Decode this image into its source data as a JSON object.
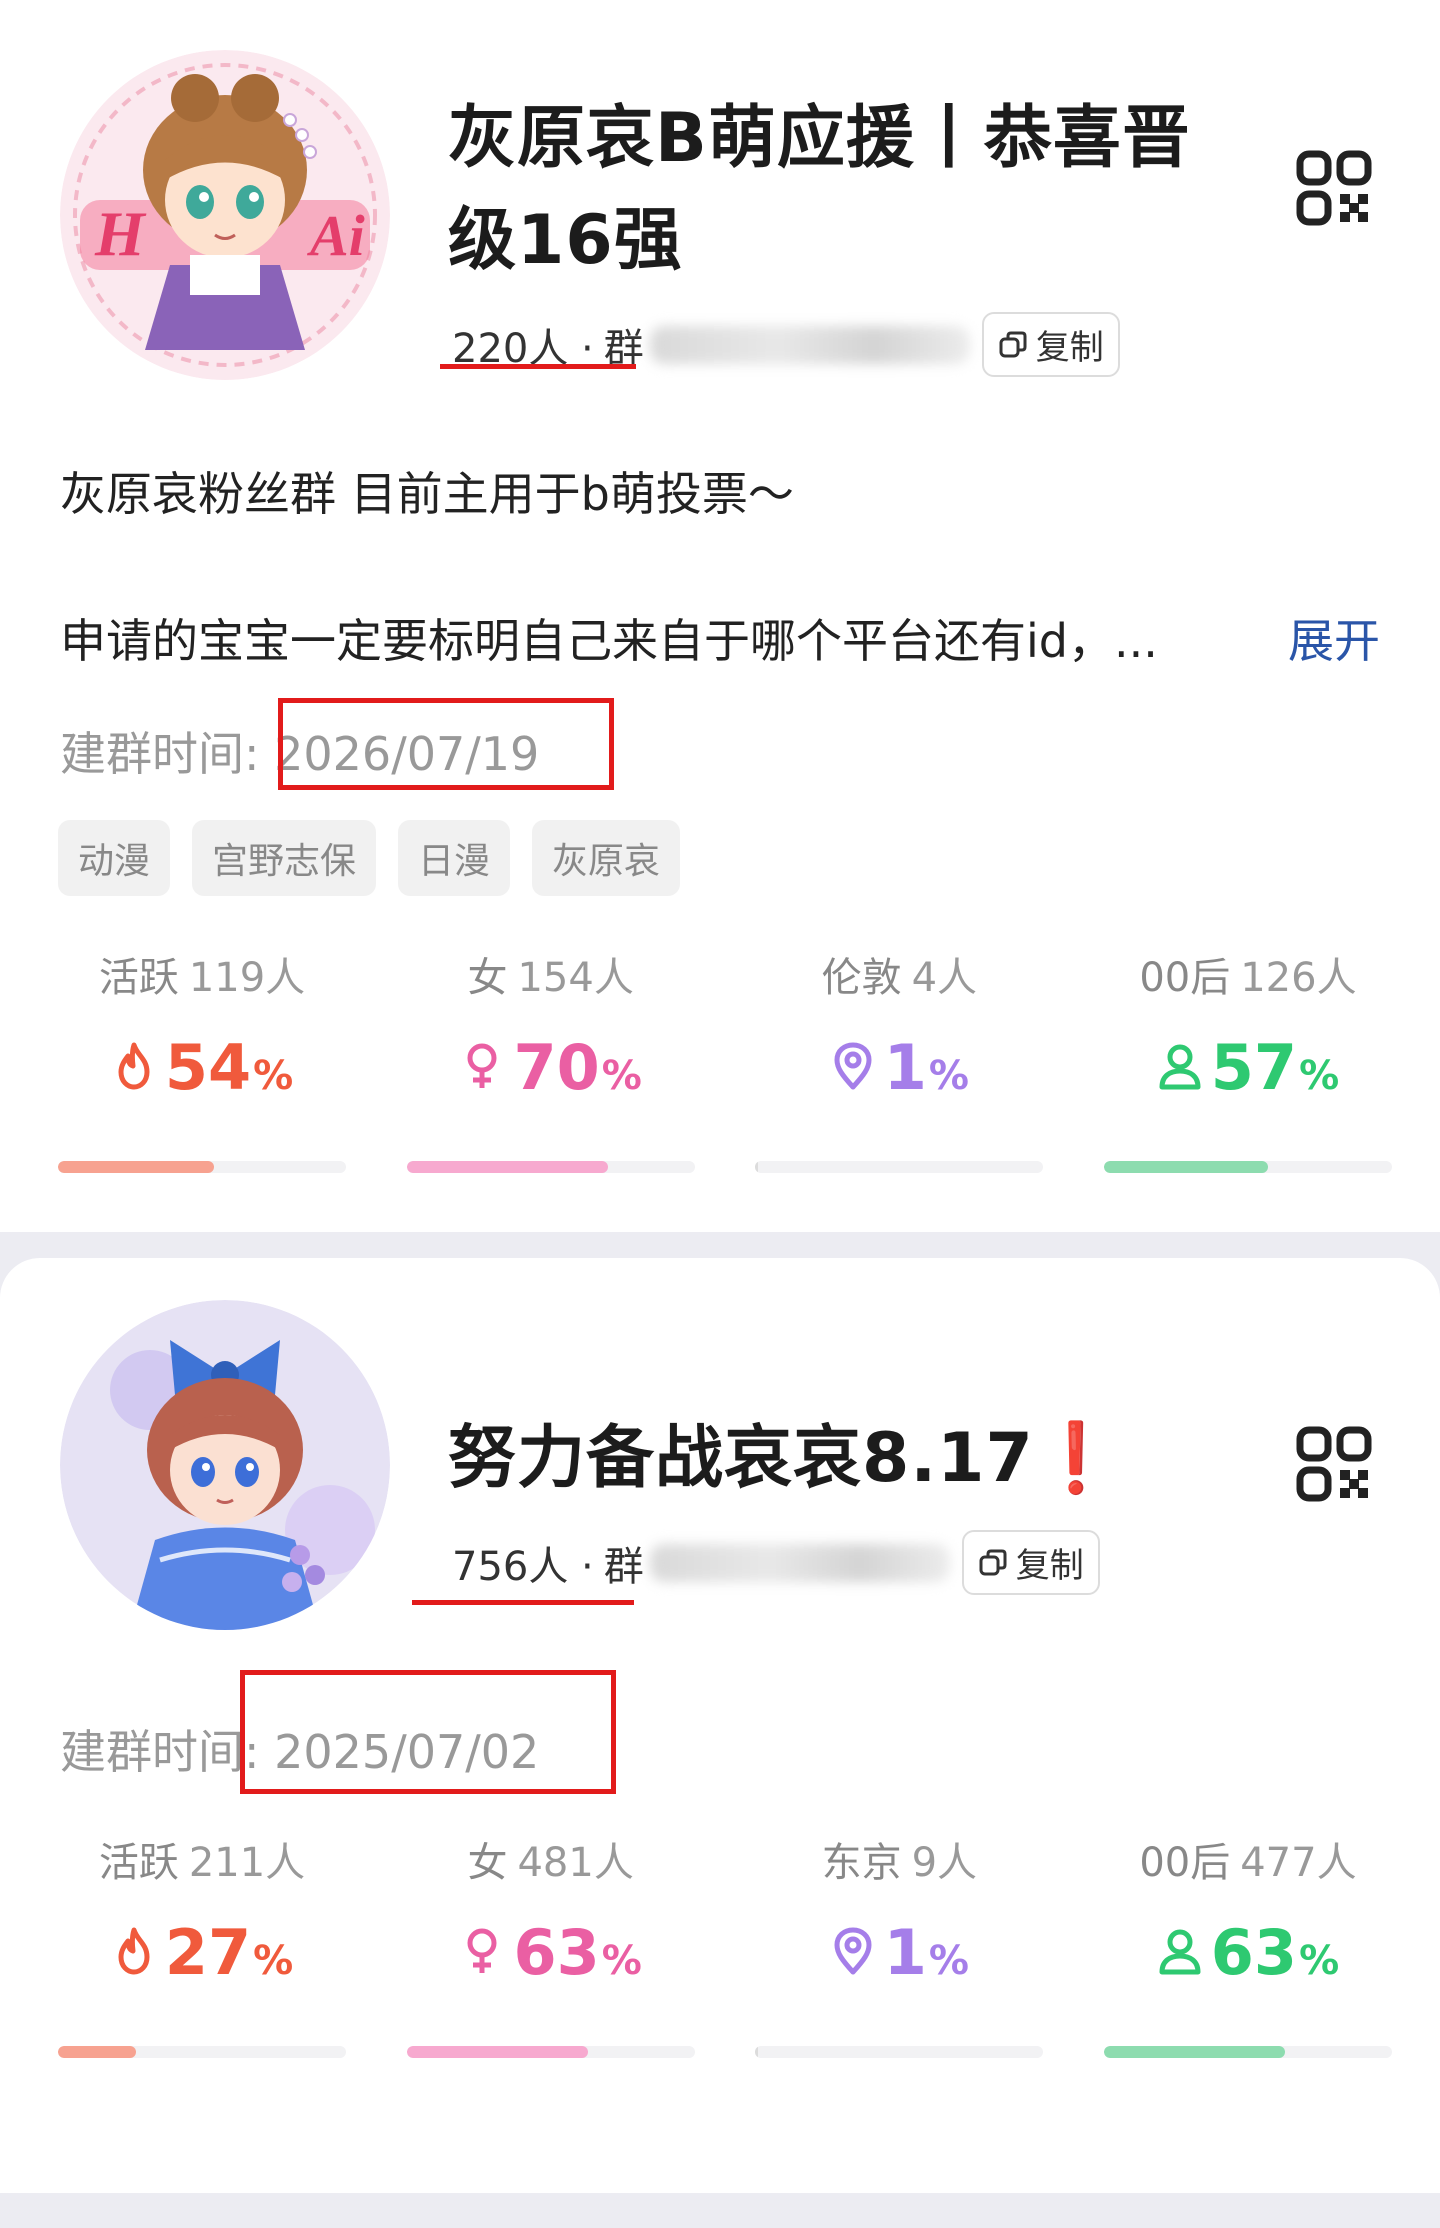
{
  "colors": {
    "active": "#f05a3c",
    "active_bar": "#f7a290",
    "female": "#ea5fa3",
    "female_bar": "#f7a9cf",
    "location": "#a57ee9",
    "location_bar": "#dcdcdc",
    "youth": "#2ec971",
    "youth_bar": "#8ddcaf",
    "link": "#2a55a8",
    "annotation_red": "#e21b1b"
  },
  "common": {
    "copy_label": "复制",
    "group_prefix": "群",
    "created_label": "建群时间:",
    "expand_label": "展开",
    "percent_sign": "%"
  },
  "groups": [
    {
      "avatar_icon": "anime-avatar-haibara-1",
      "title": "灰原哀B萌应援丨恭喜晋级16强",
      "members": "220人 ·",
      "description_line1": "灰原哀粉丝群 目前主用于b萌投票～",
      "description_line2": "申请的宝宝一定要标明自己来自于哪个平台还有id，...",
      "created_date": "2026/07/19",
      "tags": [
        "动漫",
        "宫野志保",
        "日漫",
        "灰原哀"
      ],
      "stats": [
        {
          "key": "active",
          "label": "活跃",
          "count": "119人",
          "percent": 54,
          "percent_text": "54",
          "icon": "flame-icon"
        },
        {
          "key": "female",
          "label": "女",
          "count": "154人",
          "percent": 70,
          "percent_text": "70",
          "icon": "female-icon"
        },
        {
          "key": "location",
          "label": "伦敦",
          "count": "4人",
          "percent": 1,
          "percent_text": "1",
          "icon": "location-pin-icon"
        },
        {
          "key": "youth",
          "label": "00后",
          "count": "126人",
          "percent": 57,
          "percent_text": "57",
          "icon": "person-icon"
        }
      ]
    },
    {
      "avatar_icon": "anime-avatar-haibara-2",
      "title": "努力备战哀哀8.17",
      "title_suffix": "❗",
      "members": "756人 ·",
      "created_date": "2025/07/02",
      "stats": [
        {
          "key": "active",
          "label": "活跃",
          "count": "211人",
          "percent": 27,
          "percent_text": "27",
          "icon": "flame-icon"
        },
        {
          "key": "female",
          "label": "女",
          "count": "481人",
          "percent": 63,
          "percent_text": "63",
          "icon": "female-icon"
        },
        {
          "key": "location",
          "label": "东京",
          "count": "9人",
          "percent": 1,
          "percent_text": "1",
          "icon": "location-pin-icon"
        },
        {
          "key": "youth",
          "label": "00后",
          "count": "477人",
          "percent": 63,
          "percent_text": "63",
          "icon": "person-icon"
        }
      ]
    }
  ]
}
